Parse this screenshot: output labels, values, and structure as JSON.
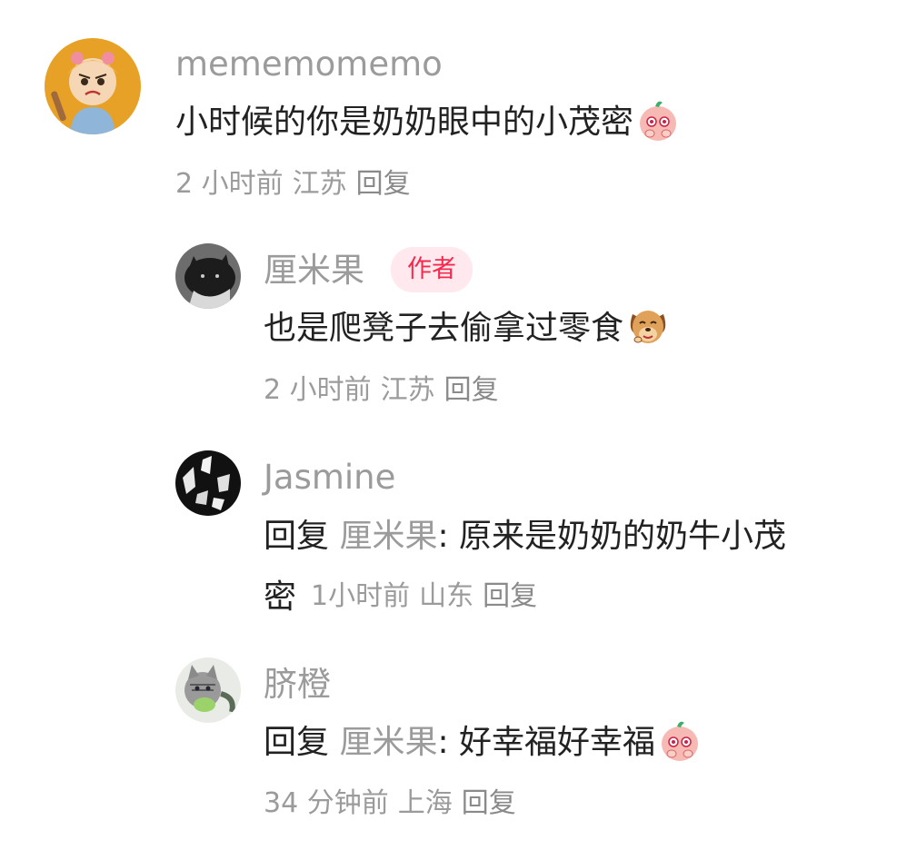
{
  "comments": [
    {
      "user": "mememomemo",
      "text": "小时候的你是奶奶眼中的小茂密",
      "emoji": "blushing-peach-emoji",
      "time": "2 小时前",
      "location": "江苏",
      "reply_label": "回复"
    },
    {
      "user": "厘米果",
      "badge": "作者",
      "text": "也是爬凳子去偷拿过零食",
      "emoji": "drooling-dog-emoji",
      "time": "2 小时前",
      "location": "江苏",
      "reply_label": "回复"
    },
    {
      "user": "Jasmine",
      "reply_prefix": "回复",
      "mention": "厘米果",
      "text_line1": ": 原来是奶奶的奶牛小茂",
      "text_line2": "密",
      "time": "1小时前",
      "location": "山东",
      "reply_label": "回复"
    },
    {
      "user": "脐橙",
      "reply_prefix": "回复",
      "mention": "厘米果",
      "text": ": 好幸福好幸福",
      "emoji": "blushing-peach-emoji",
      "time": "34 分钟前",
      "location": "上海",
      "reply_label": "回复"
    }
  ],
  "colors": {
    "text": "#222222",
    "secondary": "#9b9b9b",
    "badge_bg": "#ffe9ee",
    "badge_text": "#f5294e"
  }
}
